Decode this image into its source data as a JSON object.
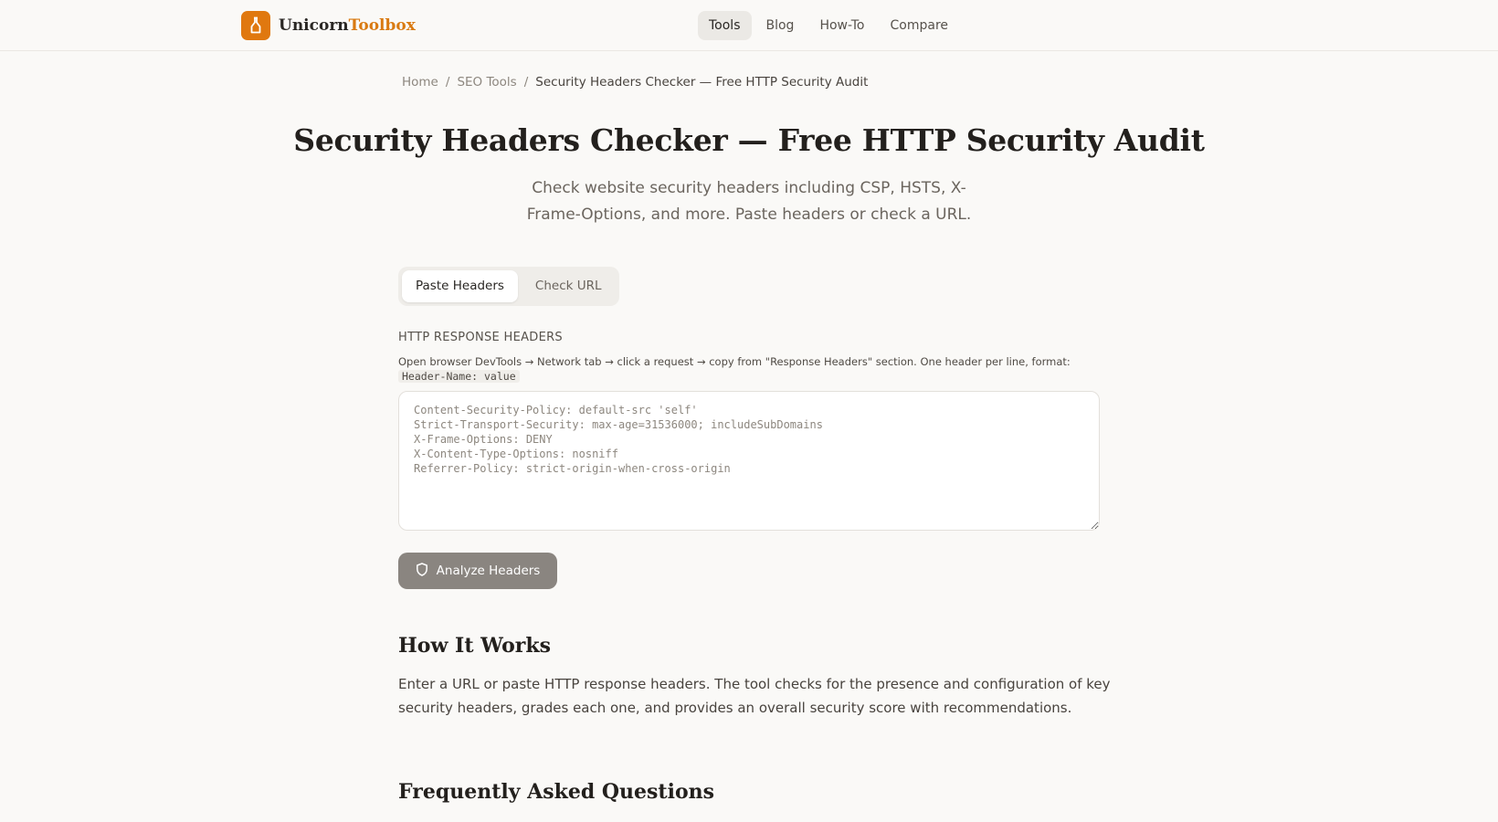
{
  "brand": {
    "name_part1": "Unicorn",
    "name_part2": "Toolbox",
    "accent_color": "#e0780f"
  },
  "nav": {
    "items": [
      {
        "label": "Tools",
        "active": true
      },
      {
        "label": "Blog",
        "active": false
      },
      {
        "label": "How-To",
        "active": false
      },
      {
        "label": "Compare",
        "active": false
      }
    ]
  },
  "breadcrumb": {
    "items": [
      "Home",
      "SEO Tools",
      "Security Headers Checker — Free HTTP Security Audit"
    ],
    "separator": "/"
  },
  "page": {
    "title": "Security Headers Checker — Free HTTP Security Audit",
    "subtitle": "Check website security headers including CSP, HSTS, X-Frame-Options, and more. Paste headers or check a URL."
  },
  "tabs": [
    {
      "label": "Paste Headers",
      "active": true
    },
    {
      "label": "Check URL",
      "active": false
    }
  ],
  "form": {
    "label": "HTTP RESPONSE HEADERS",
    "help_text": "Open browser DevTools → Network tab → click a request → copy from \"Response Headers\" section. One header per line, format:",
    "help_code": "Header-Name: value",
    "placeholder": "Content-Security-Policy: default-src 'self'\nStrict-Transport-Security: max-age=31536000; includeSubDomains\nX-Frame-Options: DENY\nX-Content-Type-Options: nosniff\nReferrer-Policy: strict-origin-when-cross-origin",
    "value": "",
    "submit_label": "Analyze Headers",
    "submit_icon": "shield-icon"
  },
  "how_it_works": {
    "heading": "How It Works",
    "body": "Enter a URL or paste HTTP response headers. The tool checks for the presence and configuration of key security headers, grades each one, and provides an overall security score with recommendations."
  },
  "faq": {
    "heading": "Frequently Asked Questions"
  }
}
